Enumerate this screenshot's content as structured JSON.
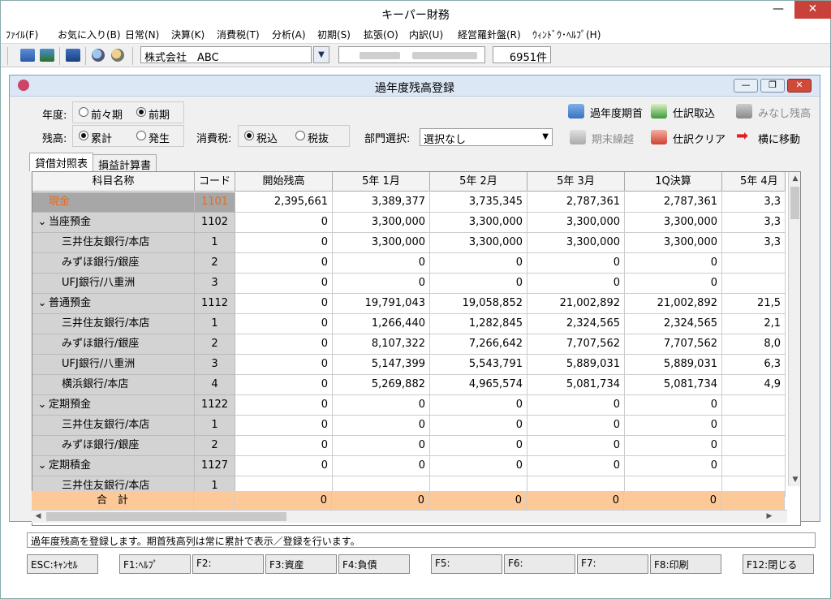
{
  "app": {
    "title": "キーパー財務"
  },
  "menu": [
    "ﾌｧｲﾙ(F)",
    "お気に入り(B)",
    "日常(N)",
    "決算(K)",
    "消費税(T)",
    "分析(A)",
    "初期(S)",
    "拡張(O)",
    "内訳(U)",
    "経営羅針盤(R)",
    "ｳｨﾝﾄﾞｳ･ﾍﾙﾌﾟ(H)"
  ],
  "toolbar": {
    "company": "株式会社　ABC",
    "count": "6951件"
  },
  "window": {
    "title": "過年度残高登録"
  },
  "form": {
    "year_label": "年度:",
    "year_opt1": "前々期",
    "year_opt2": "前期",
    "year_selected": "前期",
    "balance_label": "残高:",
    "bal_opt1": "累計",
    "bal_opt2": "発生",
    "bal_selected": "累計",
    "tax_label": "消費税:",
    "tax_opt1": "税込",
    "tax_opt2": "税抜",
    "tax_selected": "税込",
    "dept_label": "部門選択:",
    "dept_value": "選択なし"
  },
  "actions": {
    "kanen": "過年度期首",
    "shiwake_torikomi": "仕訳取込",
    "minashi": "みなし残高",
    "kimatsu": "期末繰越",
    "shiwake_clear": "仕訳クリア",
    "yoko": "横に移動"
  },
  "tabs": [
    "貸借対照表",
    "損益計算書"
  ],
  "grid": {
    "headers": [
      "科目名称",
      "コード",
      "開始残高",
      "5年 1月",
      "5年 2月",
      "5年 3月",
      "1Q決算",
      "5年 4月"
    ],
    "rows": [
      {
        "name": "現金",
        "code": "1101",
        "vals": [
          "2,395,661",
          "3,389,377",
          "3,735,345",
          "2,787,361",
          "2,787,361",
          "3,3"
        ],
        "level": 0,
        "sel": true
      },
      {
        "name": "当座預金",
        "code": "1102",
        "vals": [
          "0",
          "3,300,000",
          "3,300,000",
          "3,300,000",
          "3,300,000",
          "3,3"
        ],
        "level": 0,
        "exp": true
      },
      {
        "name": "三井住友銀行/本店",
        "code": "1",
        "vals": [
          "0",
          "3,300,000",
          "3,300,000",
          "3,300,000",
          "3,300,000",
          "3,3"
        ],
        "level": 1
      },
      {
        "name": "みずほ銀行/銀座",
        "code": "2",
        "vals": [
          "0",
          "0",
          "0",
          "0",
          "0",
          ""
        ],
        "level": 1
      },
      {
        "name": "UFJ銀行/八重洲",
        "code": "3",
        "vals": [
          "0",
          "0",
          "0",
          "0",
          "0",
          ""
        ],
        "level": 1
      },
      {
        "name": "普通預金",
        "code": "1112",
        "vals": [
          "0",
          "19,791,043",
          "19,058,852",
          "21,002,892",
          "21,002,892",
          "21,5"
        ],
        "level": 0,
        "exp": true
      },
      {
        "name": "三井住友銀行/本店",
        "code": "1",
        "vals": [
          "0",
          "1,266,440",
          "1,282,845",
          "2,324,565",
          "2,324,565",
          "2,1"
        ],
        "level": 1
      },
      {
        "name": "みずほ銀行/銀座",
        "code": "2",
        "vals": [
          "0",
          "8,107,322",
          "7,266,642",
          "7,707,562",
          "7,707,562",
          "8,0"
        ],
        "level": 1
      },
      {
        "name": "UFJ銀行/八重洲",
        "code": "3",
        "vals": [
          "0",
          "5,147,399",
          "5,543,791",
          "5,889,031",
          "5,889,031",
          "6,3"
        ],
        "level": 1
      },
      {
        "name": "横浜銀行/本店",
        "code": "4",
        "vals": [
          "0",
          "5,269,882",
          "4,965,574",
          "5,081,734",
          "5,081,734",
          "4,9"
        ],
        "level": 1
      },
      {
        "name": "定期預金",
        "code": "1122",
        "vals": [
          "0",
          "0",
          "0",
          "0",
          "0",
          ""
        ],
        "level": 0,
        "exp": true
      },
      {
        "name": "三井住友銀行/本店",
        "code": "1",
        "vals": [
          "0",
          "0",
          "0",
          "0",
          "0",
          ""
        ],
        "level": 1
      },
      {
        "name": "みずほ銀行/銀座",
        "code": "2",
        "vals": [
          "0",
          "0",
          "0",
          "0",
          "0",
          ""
        ],
        "level": 1
      },
      {
        "name": "定期積金",
        "code": "1127",
        "vals": [
          "0",
          "0",
          "0",
          "0",
          "0",
          ""
        ],
        "level": 0,
        "exp": true
      },
      {
        "name": "三井住友銀行/本店",
        "code": "1",
        "vals": [
          "",
          "",
          "",
          "",
          "",
          ""
        ],
        "level": 1
      }
    ],
    "total": {
      "name": "合　計",
      "vals": [
        "0",
        "0",
        "0",
        "0",
        "0",
        ""
      ]
    }
  },
  "status": "過年度残高を登録します。期首残高列は常に累計で表示／登録を行います。",
  "fkeys": [
    "ESC:ｷｬﾝｾﾙ",
    "F1:ﾍﾙﾌﾟ",
    "F2:",
    "F3:資産",
    "F4:負債",
    "F5:",
    "F6:",
    "F7:",
    "F8:印刷",
    "F12:閉じる"
  ],
  "colors": {
    "selected_text": "#e86b1c",
    "total_row": "#fdc999",
    "close_button": "#c8413a"
  }
}
